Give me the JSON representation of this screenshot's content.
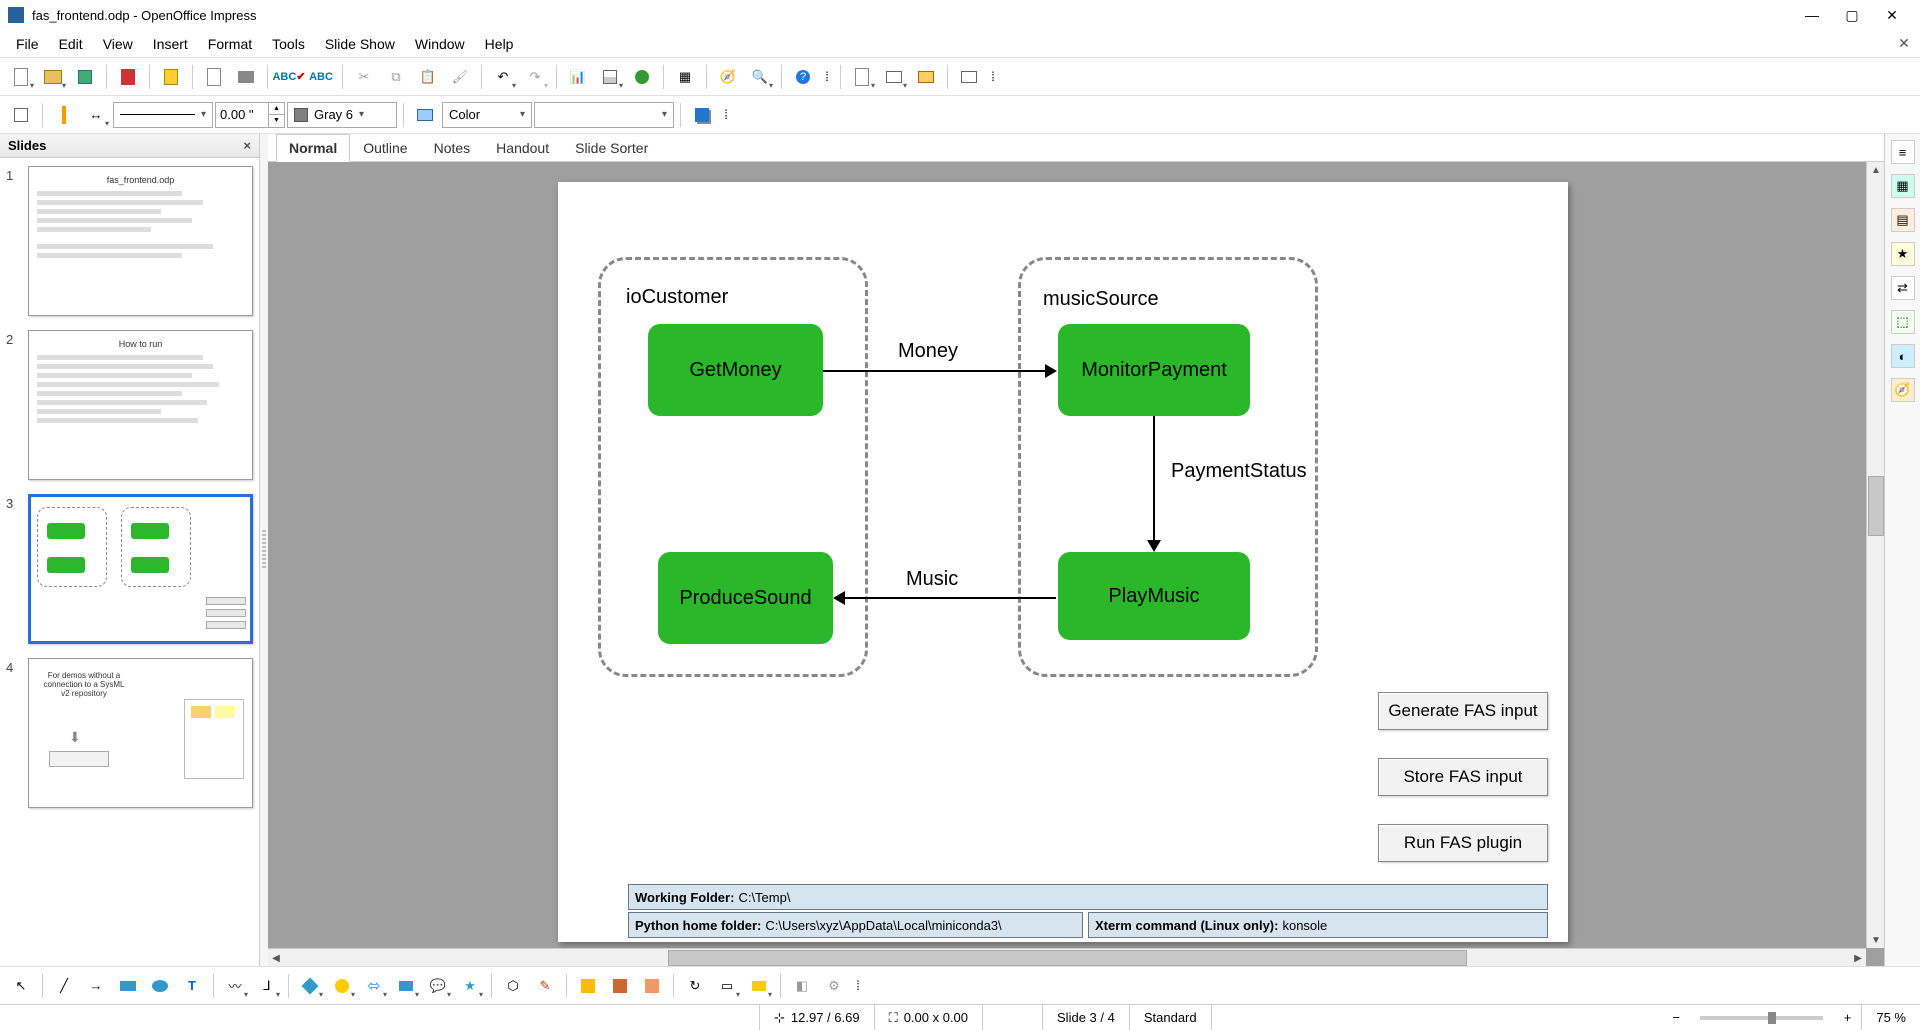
{
  "window": {
    "title": "fas_frontend.odp - OpenOffice Impress"
  },
  "menu": {
    "items": [
      "File",
      "Edit",
      "View",
      "Insert",
      "Format",
      "Tools",
      "Slide Show",
      "Window",
      "Help"
    ]
  },
  "toolbar2": {
    "line_width": "0.00 \"",
    "line_color_label": "Gray 6",
    "fill_mode": "Color"
  },
  "slides_panel": {
    "title": "Slides",
    "slides": [
      {
        "num": 1,
        "title": "fas_frontend.odp"
      },
      {
        "num": 2,
        "title": "How to run"
      },
      {
        "num": 3,
        "title": ""
      },
      {
        "num": 4,
        "title": "For demos without a connection to a SysML v2 repository"
      }
    ],
    "selected_index": 2
  },
  "view_tabs": {
    "items": [
      "Normal",
      "Outline",
      "Notes",
      "Handout",
      "Slide Sorter"
    ],
    "active": "Normal"
  },
  "diagram": {
    "group1_label": "ioCustomer",
    "group2_label": "musicSource",
    "box_get_money": "GetMoney",
    "box_monitor_payment": "MonitorPayment",
    "box_produce_sound": "ProduceSound",
    "box_play_music": "PlayMusic",
    "edge_money": "Money",
    "edge_payment_status": "PaymentStatus",
    "edge_music": "Music",
    "btn_generate": "Generate FAS input",
    "btn_store": "Store FAS input",
    "btn_run": "Run FAS plugin",
    "field_working_folder_label": "Working Folder:",
    "field_working_folder_value": " C:\\Temp\\",
    "field_python_label": "Python home folder:",
    "field_python_value": " C:\\Users\\xyz\\AppData\\Local\\miniconda3\\",
    "field_xterm_label": "Xterm command (Linux only):",
    "field_xterm_value": " konsole"
  },
  "statusbar": {
    "pos": "12.97 / 6.69",
    "size": "0.00 x 0.00",
    "slide": "Slide 3 / 4",
    "style": "Standard",
    "zoom": "75 %"
  }
}
